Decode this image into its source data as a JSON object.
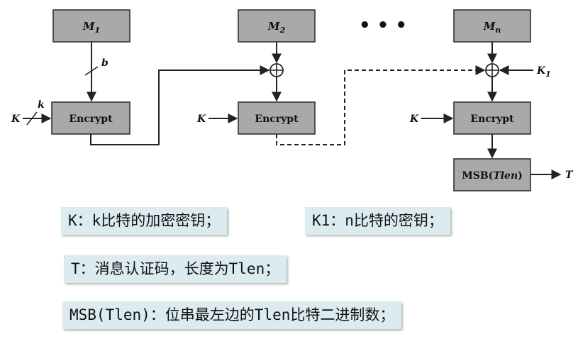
{
  "diagram": {
    "m1": {
      "base": "M",
      "sub": "1"
    },
    "m2": {
      "base": "M",
      "sub": "2"
    },
    "mn": {
      "base": "M",
      "sub": "n"
    },
    "dots": "• • •",
    "encrypt": "Encrypt",
    "msb": {
      "prefix": "MSB(",
      "var": "Tlen",
      "suffix": ")"
    },
    "label_b": "b",
    "label_k_small": "k",
    "label_K": "K",
    "label_K1": {
      "base": "K",
      "sub": "1"
    },
    "label_T": "T"
  },
  "notes": {
    "k_desc": "K：k比特的加密密钥；",
    "k1_desc": "K1：n比特的密钥；",
    "t_desc": "T：消息认证码，长度为Tlen；",
    "msb_desc": "MSB(Tlen)：位串最左边的Tlen比特二进制数；"
  }
}
